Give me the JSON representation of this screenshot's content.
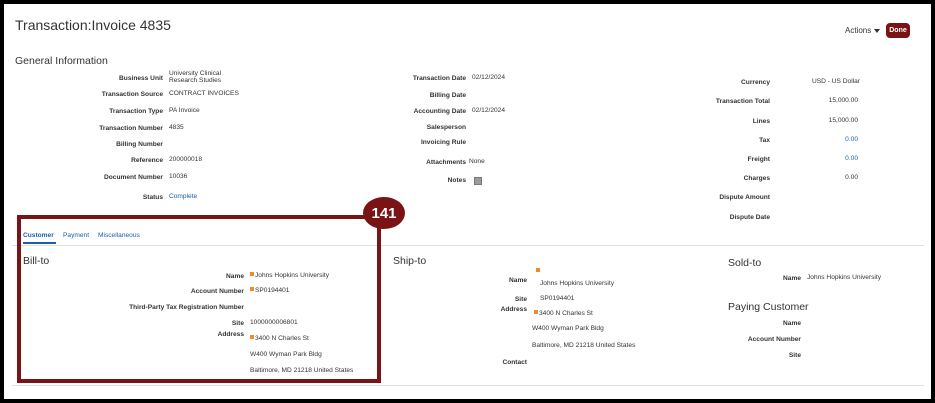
{
  "header": {
    "title": "Transaction:Invoice 4835",
    "actions_label": "Actions",
    "done_label": "Done"
  },
  "general": {
    "section_title": "General Information",
    "col1": {
      "business_unit_label": "Business Unit",
      "business_unit_value_l1": "University Clinical",
      "business_unit_value_l2": "Research Studies",
      "transaction_source_label": "Transaction Source",
      "transaction_source_value": "CONTRACT INVOICES",
      "transaction_type_label": "Transaction Type",
      "transaction_type_value": "PA Invoice",
      "transaction_number_label": "Transaction Number",
      "transaction_number_value": "4835",
      "billing_number_label": "Billing Number",
      "reference_label": "Reference",
      "reference_value": "200000018",
      "document_number_label": "Document Number",
      "document_number_value": "10036",
      "status_label": "Status",
      "status_value": "Complete"
    },
    "col2": {
      "transaction_date_label": "Transaction Date",
      "transaction_date_value": "02/12/2024",
      "billing_date_label": "Billing Date",
      "accounting_date_label": "Accounting Date",
      "accounting_date_value": "02/12/2024",
      "salesperson_label": "Salesperson",
      "invoicing_rule_label": "Invoicing Rule",
      "attachments_label": "Attachments",
      "attachments_value": "None",
      "notes_label": "Notes"
    },
    "col3": {
      "currency_label": "Currency",
      "currency_value": "USD - US Dollar",
      "transaction_total_label": "Transaction Total",
      "transaction_total_value": "15,000.00",
      "lines_label": "Lines",
      "lines_value": "15,000.00",
      "tax_label": "Tax",
      "tax_value": "0.00",
      "freight_label": "Freight",
      "freight_value": "0.00",
      "charges_label": "Charges",
      "charges_value": "0.00",
      "dispute_amount_label": "Dispute Amount",
      "dispute_date_label": "Dispute Date"
    }
  },
  "tabs": [
    "Customer",
    "Payment",
    "Miscellaneous"
  ],
  "bill_to": {
    "title": "Bill-to",
    "name_label": "Name",
    "name_value": "Johns Hopkins University",
    "account_number_label": "Account Number",
    "account_number_value": "SP0194401",
    "third_party_label": "Third-Party Tax Registration Number",
    "site_label": "Site",
    "site_value": "1000000006801",
    "address_label": "Address",
    "address_l1": "3400 N Charles St",
    "address_l2": "W400 Wyman Park Bldg",
    "address_l3": "Baltimore, MD 21218 United States"
  },
  "ship_to": {
    "title": "Ship-to",
    "name_label": "Name",
    "name_value": "Johns Hopkins University",
    "site_label": "Site",
    "site_value": "SP0194401",
    "address_label": "Address",
    "address_l1": "3400 N Charles St",
    "address_l2": "W400 Wyman Park Bldg",
    "address_l3": "Baltimore, MD 21218 United States",
    "contact_label": "Contact"
  },
  "sold_to": {
    "title": "Sold-to",
    "name_label": "Name",
    "name_value": "Johns Hopkins University"
  },
  "paying_customer": {
    "title": "Paying Customer",
    "name_label": "Name",
    "account_number_label": "Account Number",
    "site_label": "Site"
  },
  "callout": {
    "number": "141"
  },
  "colors": {
    "brand": "#7a1315",
    "link": "#1d5ea8",
    "flag": "#ec8c2b"
  },
  "icons": {
    "actions": "chevron-down-icon",
    "notes": "notes-icon",
    "flag": "flag-icon"
  }
}
